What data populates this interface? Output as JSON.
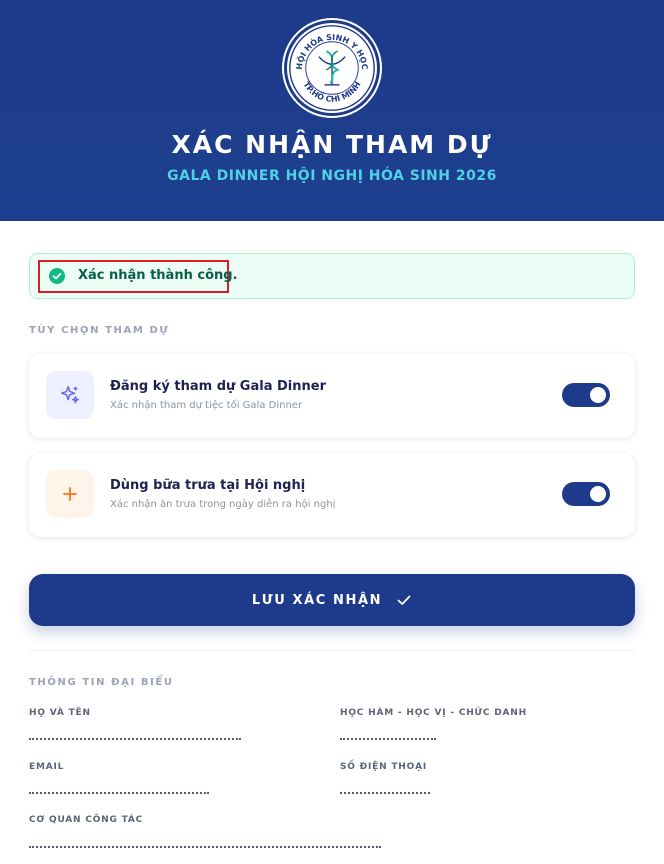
{
  "header": {
    "logo": {
      "top_text": "HỘI HÓA SINH Y HỌC",
      "bottom_text": "TP.HỒ CHÍ MINH"
    },
    "title": "XÁC NHẬN THAM DỰ",
    "subtitle": "GALA DINNER HỘI NGHỊ HÓA SINH 2026",
    "background_color": "#1e3a8a",
    "subtitle_color": "#4fd1e8"
  },
  "alert": {
    "icon": "check-circle-icon",
    "text": "Xác nhận thành công.",
    "color": "#10b981"
  },
  "options_section": {
    "label": "TÙY CHỌN THAM DỰ",
    "options": [
      {
        "icon": "sparkles-icon",
        "title": "Đăng ký tham dự Gala Dinner",
        "subtitle": "Xác nhận tham dự tiệc tối Gala Dinner",
        "enabled": true
      },
      {
        "icon": "plus-icon",
        "title": "Dùng bữa trưa tại Hội nghị",
        "subtitle": "Xác nhận ăn trưa trong ngày diễn ra hội nghị",
        "enabled": true
      }
    ]
  },
  "save_button": {
    "label": "LƯU XÁC NHẬN",
    "icon": "check-icon"
  },
  "delegate_section": {
    "label": "THÔNG TIN ĐẠI BIỂU",
    "fields": {
      "name_label": "HỌ VÀ TÊN",
      "title_label": "HỌC HÀM - HỌC VỊ - CHỨC DANH",
      "email_label": "EMAIL",
      "phone_label": "SỐ ĐIỆN THOẠI",
      "org_label": "CƠ QUAN CÔNG TÁC"
    }
  }
}
